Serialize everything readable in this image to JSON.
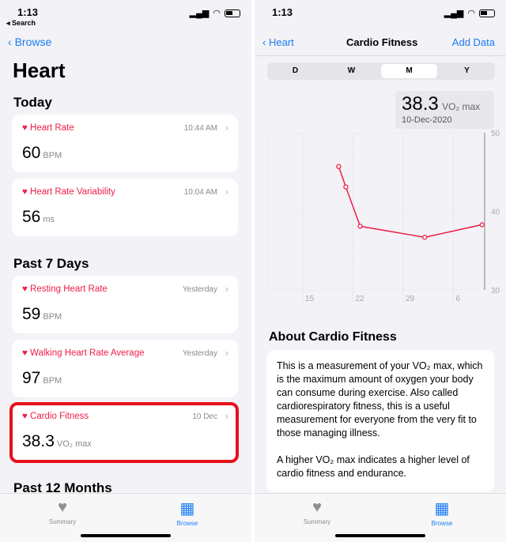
{
  "status": {
    "time": "1:13",
    "back_app": "Search"
  },
  "left": {
    "back_label": "Browse",
    "title": "Heart",
    "sections": [
      "Today",
      "Past 7 Days",
      "Past 12 Months"
    ],
    "cards": [
      {
        "title": "Heart Rate",
        "date": "10:44 AM",
        "value": "60",
        "unit": "BPM"
      },
      {
        "title": "Heart Rate Variability",
        "date": "10:04 AM",
        "value": "56",
        "unit": "ms"
      },
      {
        "title": "Resting Heart Rate",
        "date": "Yesterday",
        "value": "59",
        "unit": "BPM"
      },
      {
        "title": "Walking Heart Rate Average",
        "date": "Yesterday",
        "value": "97",
        "unit": "BPM"
      },
      {
        "title": "Cardio Fitness",
        "date": "10 Dec",
        "value": "38.3",
        "unit": "VO₂ max",
        "highlighted": true
      }
    ]
  },
  "right": {
    "back_label": "Heart",
    "title": "Cardio Fitness",
    "action": "Add Data",
    "segments": [
      "D",
      "W",
      "M",
      "Y"
    ],
    "selected_segment": "M",
    "callout": {
      "value": "38.3",
      "unit": "VO₂ max",
      "date": "10-Dec-2020"
    },
    "about_title": "About Cardio Fitness",
    "about_paragraphs": [
      "This is a measurement of your VO₂ max, which is the maximum amount of oxygen your body can consume during exercise. Also called cardiorespiratory fitness, this is a useful measurement for everyone from the very fit to those managing illness.",
      "A higher VO₂ max indicates a higher level of cardio fitness and endurance."
    ]
  },
  "tabbar": {
    "summary": "Summary",
    "browse": "Browse"
  },
  "colors": {
    "accent": "#1a7cf5",
    "heart": "#ee1d48",
    "highlight": "#e8101b"
  },
  "chart_data": {
    "type": "line",
    "x": [
      "Nov 20",
      "Nov 21",
      "Nov 23",
      "Dec 2",
      "Dec 10"
    ],
    "y": [
      45.7,
      43.1,
      38.1,
      36.7,
      38.3
    ],
    "ylim": [
      30,
      50
    ],
    "yticks": [
      "50",
      "40",
      "30"
    ],
    "xticks": [
      "15",
      "22",
      "29",
      "6"
    ],
    "grid": true,
    "color": "#ee1d48"
  }
}
